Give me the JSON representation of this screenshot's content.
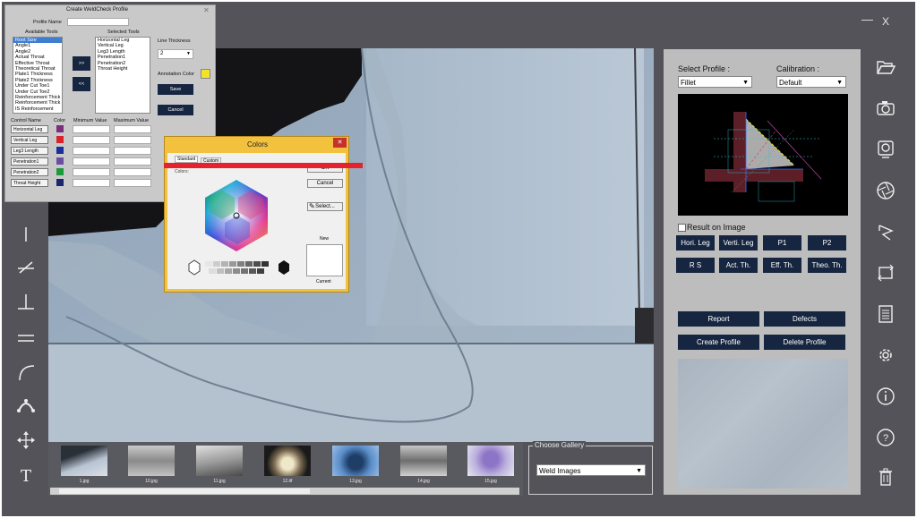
{
  "window": {
    "minimize": "—",
    "close": "X"
  },
  "profile_dialog": {
    "title": "Create WeldCheck Profile",
    "profile_name_label": "Profile Name",
    "profile_name_value": "",
    "available_label": "Available Tools",
    "selected_label": "Selected Tools",
    "available_tools": [
      "Root Size",
      "Angle1",
      "Angle2",
      "Actual Throat",
      "Effective Throat",
      "Theoretical Throat",
      "Plate1 Thickness",
      "Plate2 Thickness",
      "Under Cut Toe1",
      "Under Cut Toe2",
      "Reinforcement Thick",
      "Reinforcement Thick",
      "IS Reinforcement"
    ],
    "selected_tools": [
      "Horizontal Leg",
      "Vertical Leg",
      "Leg3 Length",
      "Penetration1",
      "Penetration2",
      "Throat Height"
    ],
    "add_button": ">>",
    "remove_button": "<<",
    "line_thickness_label": "Line Thickness",
    "line_thickness_value": "2",
    "annotation_color_label": "Annotation Color",
    "save_button": "Save",
    "cancel_button": "Cancel",
    "col_control": "Control Name",
    "col_color": "Color",
    "col_min": "Minimum Value",
    "col_max": "Maximum Value",
    "controls": [
      {
        "name": "Horizontal Leg",
        "color": "#7b2d7e"
      },
      {
        "name": "Vertical Leg",
        "color": "#d8232a"
      },
      {
        "name": "Leg3 Length",
        "color": "#1c2e9c"
      },
      {
        "name": "Penetration1",
        "color": "#6a4fa0"
      },
      {
        "name": "Penetration2",
        "color": "#1d9a3c"
      },
      {
        "name": "Throat Height",
        "color": "#1a2470"
      }
    ]
  },
  "colors_dialog": {
    "title": "Colors",
    "tab_standard": "Standard",
    "tab_custom": "Custom",
    "colors_label": "Colors:",
    "ok_button": "OK",
    "cancel_button": "Cancel",
    "select_button": "Select...",
    "new_label": "New",
    "current_label": "Current"
  },
  "right_panel": {
    "select_profile_label": "Select Profile :",
    "select_profile_value": "Fillet",
    "calibration_label": "Calibration :",
    "calibration_value": "Default",
    "result_on_image_label": "Result on Image",
    "tool_buttons": [
      "Hori. Leg",
      "Verti. Leg",
      "P1",
      "P2",
      "R S",
      "Act. Th.",
      "Eff. Th.",
      "Theo. Th."
    ],
    "report_button": "Report",
    "defects_button": "Defects",
    "create_profile_button": "Create Profile",
    "delete_profile_button": "Delete Profile"
  },
  "gallery": {
    "legend": "Choose Gallery",
    "value": "Weld Images",
    "thumbnails": [
      "1.jpg",
      "10.jpg",
      "11.jpg",
      "12.tif",
      "13.jpg",
      "14.jpg",
      "15.jpg"
    ]
  },
  "left_tools": [
    "line-tool",
    "angle-tool",
    "perpendicular-tool",
    "parallel-tool",
    "arc-tool",
    "arc-points-tool",
    "move-tool",
    "text-tool"
  ],
  "left_tools_text": "T",
  "right_icons": [
    "folder-open-icon",
    "camera-icon",
    "webcam-icon",
    "aperture-icon",
    "transform-icon",
    "rotate-icon",
    "document-icon",
    "settings-icon",
    "info-icon",
    "help-icon",
    "trash-icon"
  ],
  "colors": {
    "accent_navy": "#172640",
    "annotation_color": "#f1e22a",
    "highlight_red": "#e4232e"
  }
}
